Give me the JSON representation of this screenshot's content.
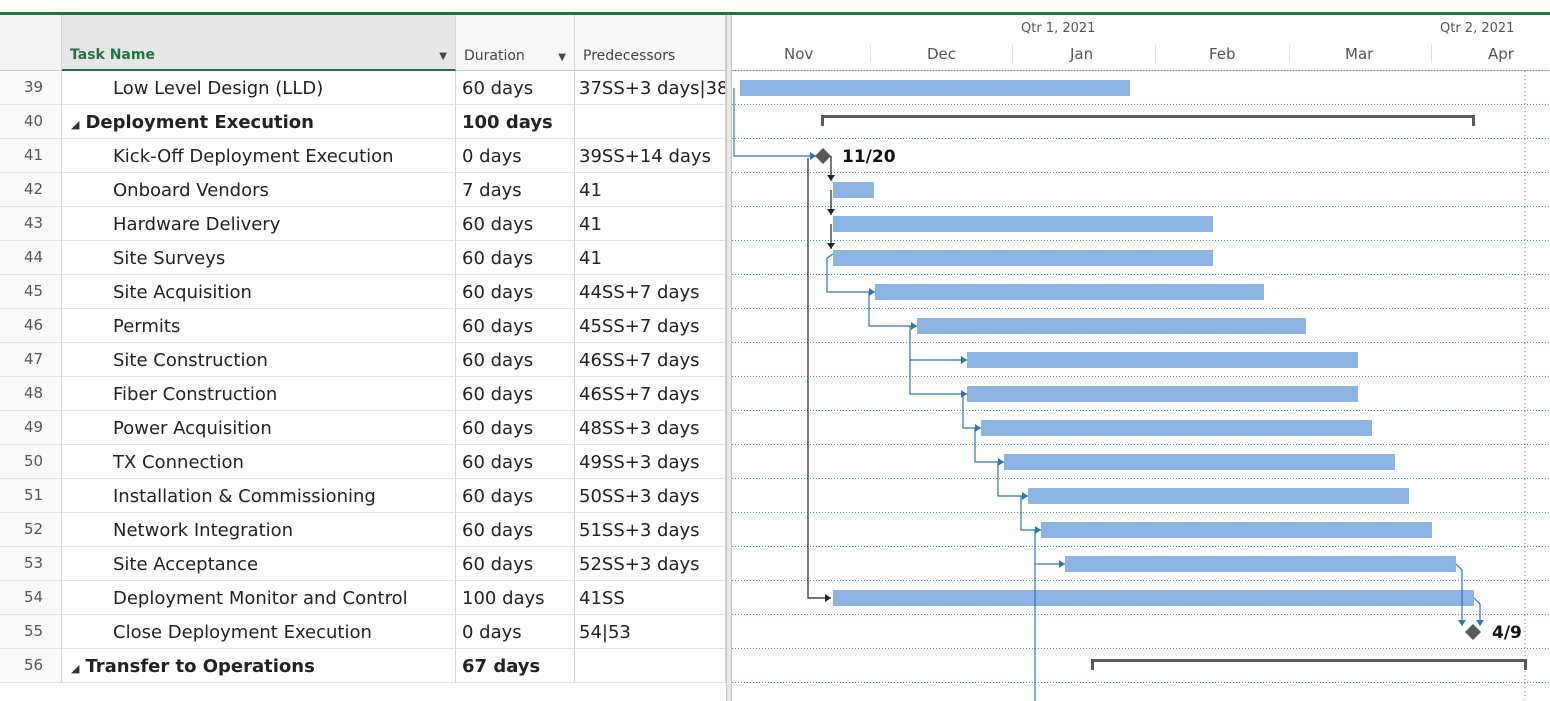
{
  "columns": {
    "task_name": "Task Name",
    "duration": "Duration",
    "predecessors": "Predecessors"
  },
  "timescale": {
    "quarters": [
      {
        "label": "Qtr 1, 2021"
      },
      {
        "label": "Qtr 2, 2021"
      }
    ],
    "months": [
      "Nov",
      "Dec",
      "Jan",
      "Feb",
      "Mar",
      "Apr"
    ]
  },
  "rows": [
    {
      "id": "39",
      "name": "Low Level Design (LLD)",
      "duration": "60 days",
      "predecessors": "37SS+3 days|38",
      "summary": false
    },
    {
      "id": "40",
      "name": "Deployment Execution",
      "duration": "100 days",
      "predecessors": "",
      "summary": true
    },
    {
      "id": "41",
      "name": "Kick-Off Deployment Execution",
      "duration": "0 days",
      "predecessors": "39SS+14 days",
      "summary": false
    },
    {
      "id": "42",
      "name": "Onboard Vendors",
      "duration": "7 days",
      "predecessors": "41",
      "summary": false
    },
    {
      "id": "43",
      "name": "Hardware Delivery",
      "duration": "60 days",
      "predecessors": "41",
      "summary": false
    },
    {
      "id": "44",
      "name": "Site Surveys",
      "duration": "60 days",
      "predecessors": "41",
      "summary": false
    },
    {
      "id": "45",
      "name": "Site Acquisition",
      "duration": "60 days",
      "predecessors": "44SS+7 days",
      "summary": false
    },
    {
      "id": "46",
      "name": "Permits",
      "duration": "60 days",
      "predecessors": "45SS+7 days",
      "summary": false
    },
    {
      "id": "47",
      "name": "Site Construction",
      "duration": "60 days",
      "predecessors": "46SS+7 days",
      "summary": false
    },
    {
      "id": "48",
      "name": "Fiber Construction",
      "duration": "60 days",
      "predecessors": "46SS+7 days",
      "summary": false
    },
    {
      "id": "49",
      "name": "Power Acquisition",
      "duration": "60 days",
      "predecessors": "48SS+3 days",
      "summary": false
    },
    {
      "id": "50",
      "name": "TX Connection",
      "duration": "60 days",
      "predecessors": "49SS+3 days",
      "summary": false
    },
    {
      "id": "51",
      "name": "Installation & Commissioning",
      "duration": "60 days",
      "predecessors": "50SS+3 days",
      "summary": false
    },
    {
      "id": "52",
      "name": "Network Integration",
      "duration": "60 days",
      "predecessors": "51SS+3 days",
      "summary": false
    },
    {
      "id": "53",
      "name": "Site Acceptance",
      "duration": "60 days",
      "predecessors": "52SS+3 days",
      "summary": false
    },
    {
      "id": "54",
      "name": "Deployment Monitor and Control",
      "duration": "100 days",
      "predecessors": "41SS",
      "summary": false
    },
    {
      "id": "55",
      "name": "Close Deployment Execution",
      "duration": "0 days",
      "predecessors": "54|53",
      "summary": false
    },
    {
      "id": "56",
      "name": "Transfer to Operations",
      "duration": "67 days",
      "predecessors": "",
      "summary": true
    }
  ],
  "milestone_labels": {
    "kickoff": "11/20",
    "close": "4/9"
  },
  "colors": {
    "task_bar": "#8db4e2",
    "link": "#2e75b6",
    "summary_bar": "#595959",
    "milestone": "#595959",
    "header_accent": "#217346"
  },
  "icons": {
    "expand_triangle": "◢",
    "dropdown": "▼"
  }
}
